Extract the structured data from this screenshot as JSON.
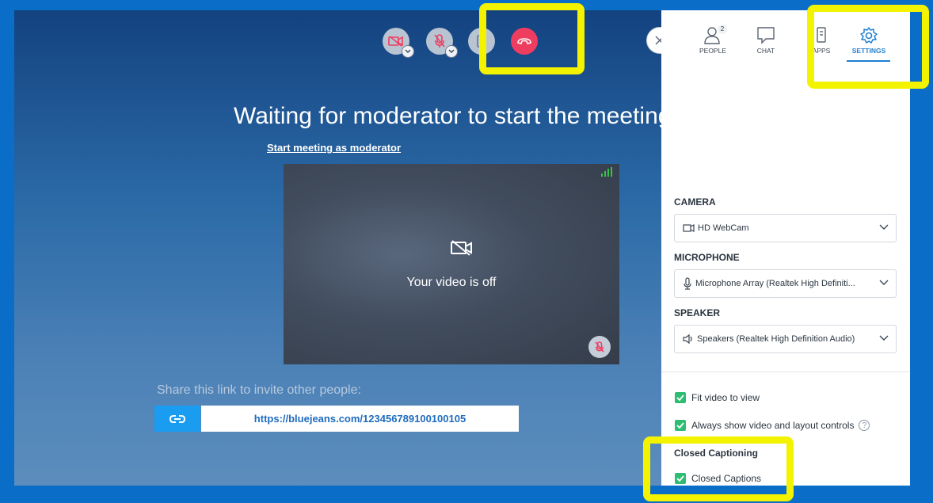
{
  "meeting": {
    "waiting_title": "Waiting for moderator to start the meeting",
    "start_link": "Start meeting as moderator",
    "video_off_text": "Your video is off",
    "share_label": "Share this link to invite other people:",
    "share_url": "https://bluejeans.com/123456789100100105"
  },
  "controls": {
    "video_icon": "video-off-icon",
    "mic_icon": "mic-off-icon",
    "screen_icon": "screen-share-icon",
    "hangup_icon": "phone-hangup-icon"
  },
  "panel": {
    "tabs": [
      {
        "label": "PEOPLE",
        "badge": "2"
      },
      {
        "label": "CHAT"
      },
      {
        "label": "APPS"
      },
      {
        "label": "SETTINGS",
        "active": true
      }
    ],
    "camera": {
      "label": "CAMERA",
      "value": "HD WebCam"
    },
    "microphone": {
      "label": "MICROPHONE",
      "value": "Microphone Array (Realtek High Definiti..."
    },
    "speaker": {
      "label": "SPEAKER",
      "value": "Speakers (Realtek High Definition Audio)"
    },
    "options": {
      "fit_video": "Fit video to view",
      "always_show": "Always show video and layout controls",
      "help": "?",
      "cc_heading": "Closed Captioning",
      "cc_label": "Closed Captions"
    }
  },
  "colors": {
    "background": "#0a6dc8",
    "hangup": "#ef3d60",
    "accent": "#1f7fd1",
    "check": "#2ebd72",
    "highlight": "#f3f300"
  }
}
